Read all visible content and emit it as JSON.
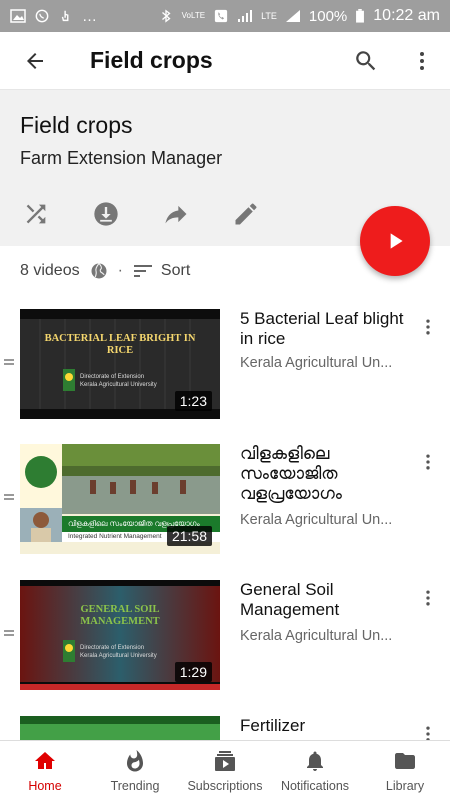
{
  "status_bar": {
    "battery": "100%",
    "time": "10:22 am",
    "network": "LTE",
    "volte": "VoLTE"
  },
  "app_bar": {
    "title": "Field crops"
  },
  "playlist": {
    "title": "Field crops",
    "owner": "Farm Extension Manager",
    "video_count": "8 videos",
    "sort_label": "Sort"
  },
  "videos": [
    {
      "title": "5 Bacterial Leaf blight in rice",
      "channel": "Kerala Agricultural Un...",
      "duration": "1:23",
      "thumb_text": "BACTERIAL LEAF BRIGHT IN RICE",
      "thumb_sub1": "Directorate of Extension",
      "thumb_sub2": "Kerala Agricultural University"
    },
    {
      "title": "വിളകളിലെ സംയോജിത വളപ്രയോഗം",
      "channel": "Kerala Agricultural Un...",
      "duration": "21:58",
      "thumb_text": "വിളകളിലെ സംയോജിത വളപ്രയോഗം",
      "thumb_sub1": "Integrated Nutrient Management"
    },
    {
      "title": "General Soil Management",
      "channel": "Kerala Agricultural Un...",
      "duration": "1:29",
      "thumb_text": "GENERAL SOIL MANAGEMENT",
      "thumb_sub1": "Directorate of Extension",
      "thumb_sub2": "Kerala Agricultural University"
    },
    {
      "title": "Fertilizer",
      "channel": "",
      "duration": ""
    }
  ],
  "bottom_nav": [
    {
      "label": "Home",
      "icon": "home-icon",
      "active": true
    },
    {
      "label": "Trending",
      "icon": "flame-icon",
      "active": false
    },
    {
      "label": "Subscriptions",
      "icon": "subscriptions-icon",
      "active": false
    },
    {
      "label": "Notifications",
      "icon": "bell-icon",
      "active": false
    },
    {
      "label": "Library",
      "icon": "folder-icon",
      "active": false
    }
  ],
  "colors": {
    "accent": "#ee1c1c",
    "active_nav": "#d40000",
    "header_bg": "#f1f1f1",
    "status_bar": "#9e9e9e"
  }
}
